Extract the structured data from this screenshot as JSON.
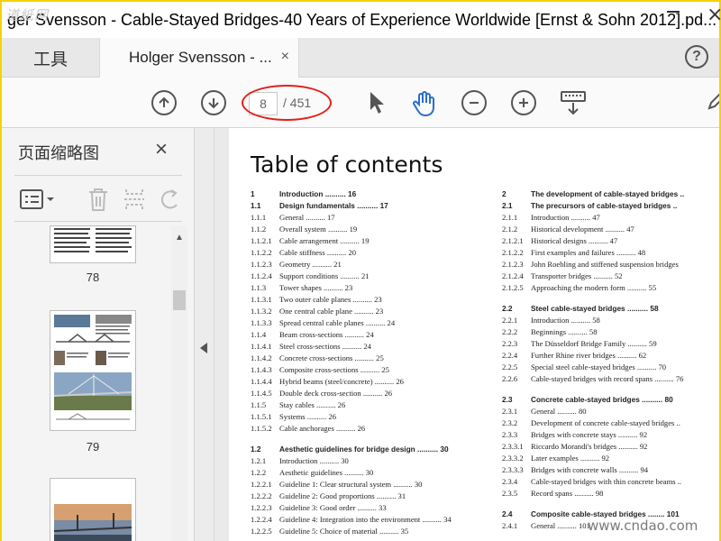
{
  "window": {
    "watermark_logo": "道紙网",
    "title": "ger Svensson - Cable-Stayed Bridges-40 Years of Experience Worldwide [Ernst & Sohn 2012].pd..."
  },
  "tabs": {
    "tools_label": "工具",
    "doc_label": "Holger Svensson - ...",
    "close_glyph": "×",
    "help_glyph": "?"
  },
  "toolbar": {
    "current_page": "8",
    "total_pages": "/ 451",
    "icons": [
      "prev-page-icon",
      "next-page-icon",
      "select-pointer-icon",
      "hand-tool-icon",
      "zoom-out-icon",
      "zoom-in-icon",
      "keyboard-icon"
    ]
  },
  "panel": {
    "title": "页面缩略图",
    "close_glyph": "×",
    "thumbnails": [
      {
        "label": "78"
      },
      {
        "label": "79"
      }
    ]
  },
  "document": {
    "title": "Table of contents",
    "left_column": [
      {
        "num": "1",
        "text": "Introduction .......... 16",
        "h": true
      },
      {
        "num": "1.1",
        "text": "Design fundamentals .......... 17",
        "h": true
      },
      {
        "num": "1.1.1",
        "text": "General .......... 17"
      },
      {
        "num": "1.1.2",
        "text": "Overall system .......... 19"
      },
      {
        "num": "1.1.2.1",
        "text": "Cable arrangement .......... 19"
      },
      {
        "num": "1.1.2.2",
        "text": "Cable stiffness .......... 20"
      },
      {
        "num": "1.1.2.3",
        "text": "Geometry .......... 21"
      },
      {
        "num": "1.1.2.4",
        "text": "Support conditions .......... 21"
      },
      {
        "num": "1.1.3",
        "text": "Tower shapes .......... 23"
      },
      {
        "num": "1.1.3.1",
        "text": "Two outer cable planes .......... 23"
      },
      {
        "num": "1.1.3.2",
        "text": "One central cable plane .......... 23"
      },
      {
        "num": "1.1.3.3",
        "text": "Spread central cable planes .......... 24"
      },
      {
        "num": "1.1.4",
        "text": "Beam cross-sections .......... 24"
      },
      {
        "num": "1.1.4.1",
        "text": "Steel cross-sections .......... 24"
      },
      {
        "num": "1.1.4.2",
        "text": "Concrete cross-sections .......... 25"
      },
      {
        "num": "1.1.4.3",
        "text": "Composite cross-sections .......... 25"
      },
      {
        "num": "1.1.4.4",
        "text": "Hybrid beams (steel/concrete) .......... 26"
      },
      {
        "num": "1.1.4.5",
        "text": "Double deck cross-section .......... 26"
      },
      {
        "num": "1.1.5",
        "text": "Stay cables .......... 26"
      },
      {
        "num": "1.1.5.1",
        "text": "Systems .......... 26"
      },
      {
        "num": "1.1.5.2",
        "text": "Cable anchorages .......... 26"
      },
      {
        "gap": true
      },
      {
        "num": "1.2",
        "text": "Aesthetic guidelines for bridge design .......... 30",
        "h": true
      },
      {
        "num": "1.2.1",
        "text": "Introduction .......... 30"
      },
      {
        "num": "1.2.2",
        "text": "Aesthetic guidelines .......... 30"
      },
      {
        "num": "1.2.2.1",
        "text": "Guideline 1: Clear structural system .......... 30"
      },
      {
        "num": "1.2.2.2",
        "text": "Guideline 2: Good proportions .......... 31"
      },
      {
        "num": "1.2.2.3",
        "text": "Guideline 3: Good order .......... 33"
      },
      {
        "num": "1.2.2.4",
        "text": "Guideline 4: Integration into the environment .......... 34"
      },
      {
        "num": "1.2.2.5",
        "text": "Guideline 5: Choice of material .......... 35"
      }
    ],
    "right_column": [
      {
        "num": "2",
        "text": "The development of cable-stayed bridges ..",
        "h": true
      },
      {
        "num": "2.1",
        "text": "The precursors of cable-stayed bridges ..",
        "h": true
      },
      {
        "num": "2.1.1",
        "text": "Introduction .......... 47"
      },
      {
        "num": "2.1.2",
        "text": "Historical development .......... 47"
      },
      {
        "num": "2.1.2.1",
        "text": "Historical designs .......... 47"
      },
      {
        "num": "2.1.2.2",
        "text": "First examples and failures .......... 48"
      },
      {
        "num": "2.1.2.3",
        "text": "John Roebling and stiffened suspension bridges"
      },
      {
        "num": "2.1.2.4",
        "text": "Transporter bridges .......... 52"
      },
      {
        "num": "2.1.2.5",
        "text": "Approaching the modern form .......... 55"
      },
      {
        "gap": true
      },
      {
        "num": "2.2",
        "text": "Steel cable-stayed bridges .......... 58",
        "h": true
      },
      {
        "num": "2.2.1",
        "text": "Introduction .......... 58"
      },
      {
        "num": "2.2.2",
        "text": "Beginnings .......... 58"
      },
      {
        "num": "2.2.3",
        "text": "The Düsseldorf Bridge Family .......... 59"
      },
      {
        "num": "2.2.4",
        "text": "Further Rhine river bridges .......... 62"
      },
      {
        "num": "2.2.5",
        "text": "Special steel cable-stayed bridges .......... 70"
      },
      {
        "num": "2.2.6",
        "text": "Cable-stayed bridges with record spans .......... 76"
      },
      {
        "gap": true
      },
      {
        "num": "2.3",
        "text": "Concrete cable-stayed bridges .......... 80",
        "h": true
      },
      {
        "num": "2.3.1",
        "text": "General .......... 80"
      },
      {
        "num": "2.3.2",
        "text": "Development of concrete cable-stayed bridges .."
      },
      {
        "num": "2.3.3",
        "text": "Bridges with concrete stays .......... 92"
      },
      {
        "num": "2.3.3.1",
        "text": "Riccardo Morandi's bridges .......... 92"
      },
      {
        "num": "2.3.3.2",
        "text": "Later examples .......... 92"
      },
      {
        "num": "2.3.3.3",
        "text": "Bridges with concrete walls .......... 94"
      },
      {
        "num": "2.3.4",
        "text": "Cable-stayed bridges with thin concrete beams .."
      },
      {
        "num": "2.3.5",
        "text": "Record spans .......... 98"
      },
      {
        "gap": true
      },
      {
        "num": "2.4",
        "text": "Composite cable-stayed bridges ........ 101",
        "h": true
      },
      {
        "num": "2.4.1",
        "text": "General .......... 101"
      }
    ]
  },
  "site_watermark": "www.cndao.com"
}
